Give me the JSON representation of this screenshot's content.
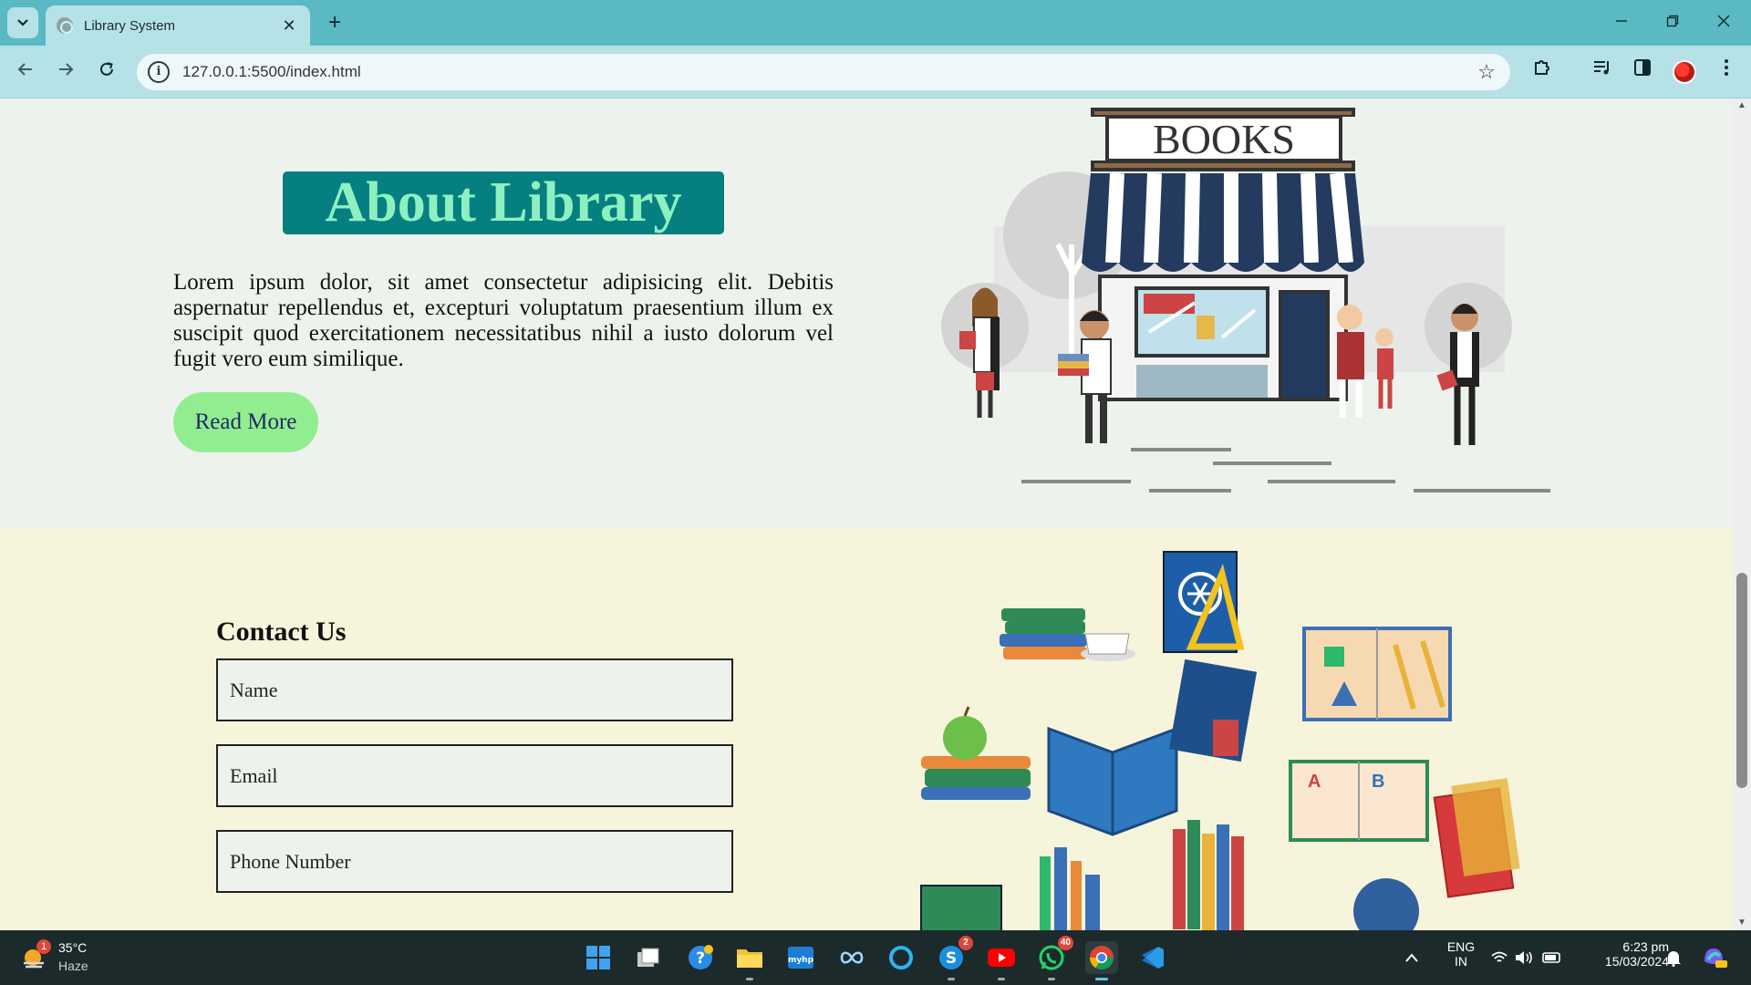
{
  "browser": {
    "tab_title": "Library System",
    "url": "127.0.0.1:5500/index.html",
    "new_tab_label": "+",
    "tab_close_label": "✕"
  },
  "about": {
    "title": "About Library",
    "body": "Lorem ipsum dolor, sit amet consectetur adipisicing elit. Debitis aspernatur repellendus et, excepturi voluptatum praesentium illum ex suscipit quod exercitationem necessitatibus nihil a iusto dolorum vel fugit vero eum similique.",
    "read_more_label": "Read More",
    "illustration_sign": "BOOKS"
  },
  "contact": {
    "title": "Contact Us",
    "fields": [
      {
        "placeholder": "Name"
      },
      {
        "placeholder": "Email"
      },
      {
        "placeholder": "Phone Number"
      }
    ]
  },
  "taskbar": {
    "weather_temp": "35°C",
    "weather_cond": "Haze",
    "weather_badge": "1",
    "skype_badge": "2",
    "whatsapp_badge": "40",
    "lang": "ENG",
    "region": "IN",
    "time": "6:23 pm",
    "date": "15/03/2024"
  },
  "colors": {
    "tab_bar": "#5bb9c4",
    "toolbar": "#b5e2e7",
    "about_bg": "#eef2ec",
    "title_bg": "#067f81",
    "title_text": "#8df0c0",
    "read_more_bg": "#90ee90",
    "contact_bg": "#f6f4db"
  }
}
